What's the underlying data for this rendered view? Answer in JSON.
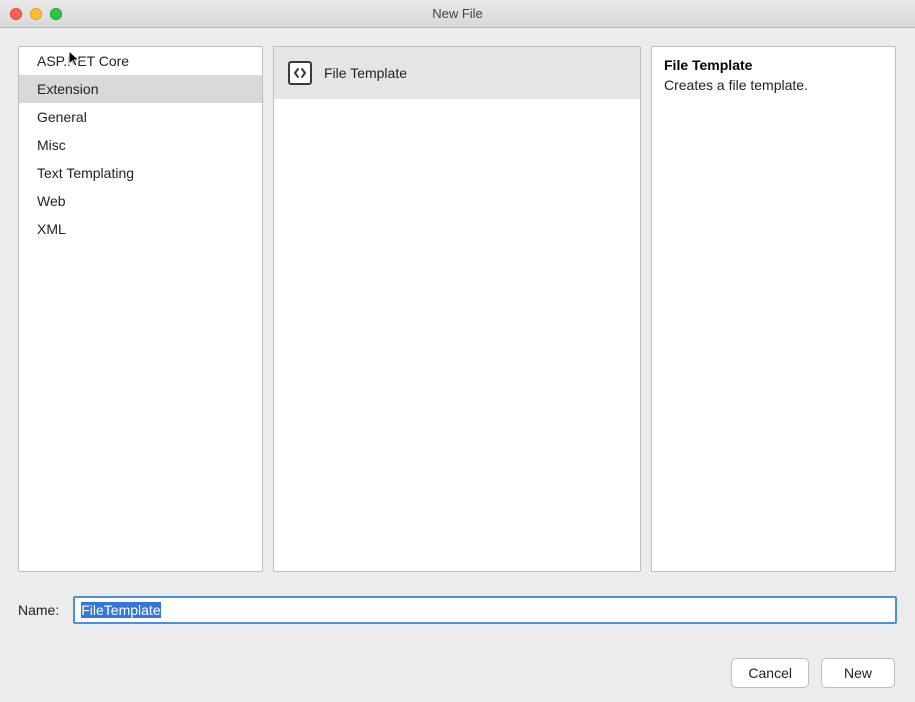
{
  "window": {
    "title": "New File"
  },
  "categories": [
    {
      "label": "ASP.NET Core",
      "selected": false
    },
    {
      "label": "Extension",
      "selected": true
    },
    {
      "label": "General",
      "selected": false
    },
    {
      "label": "Misc",
      "selected": false
    },
    {
      "label": "Text Templating",
      "selected": false
    },
    {
      "label": "Web",
      "selected": false
    },
    {
      "label": "XML",
      "selected": false
    }
  ],
  "templates": [
    {
      "label": "File Template",
      "selected": true,
      "icon": "code-file-icon"
    }
  ],
  "description": {
    "title": "File Template",
    "text": "Creates a file template."
  },
  "name_field": {
    "label": "Name:",
    "value": "FileTemplate"
  },
  "buttons": {
    "cancel": "Cancel",
    "new": "New"
  }
}
